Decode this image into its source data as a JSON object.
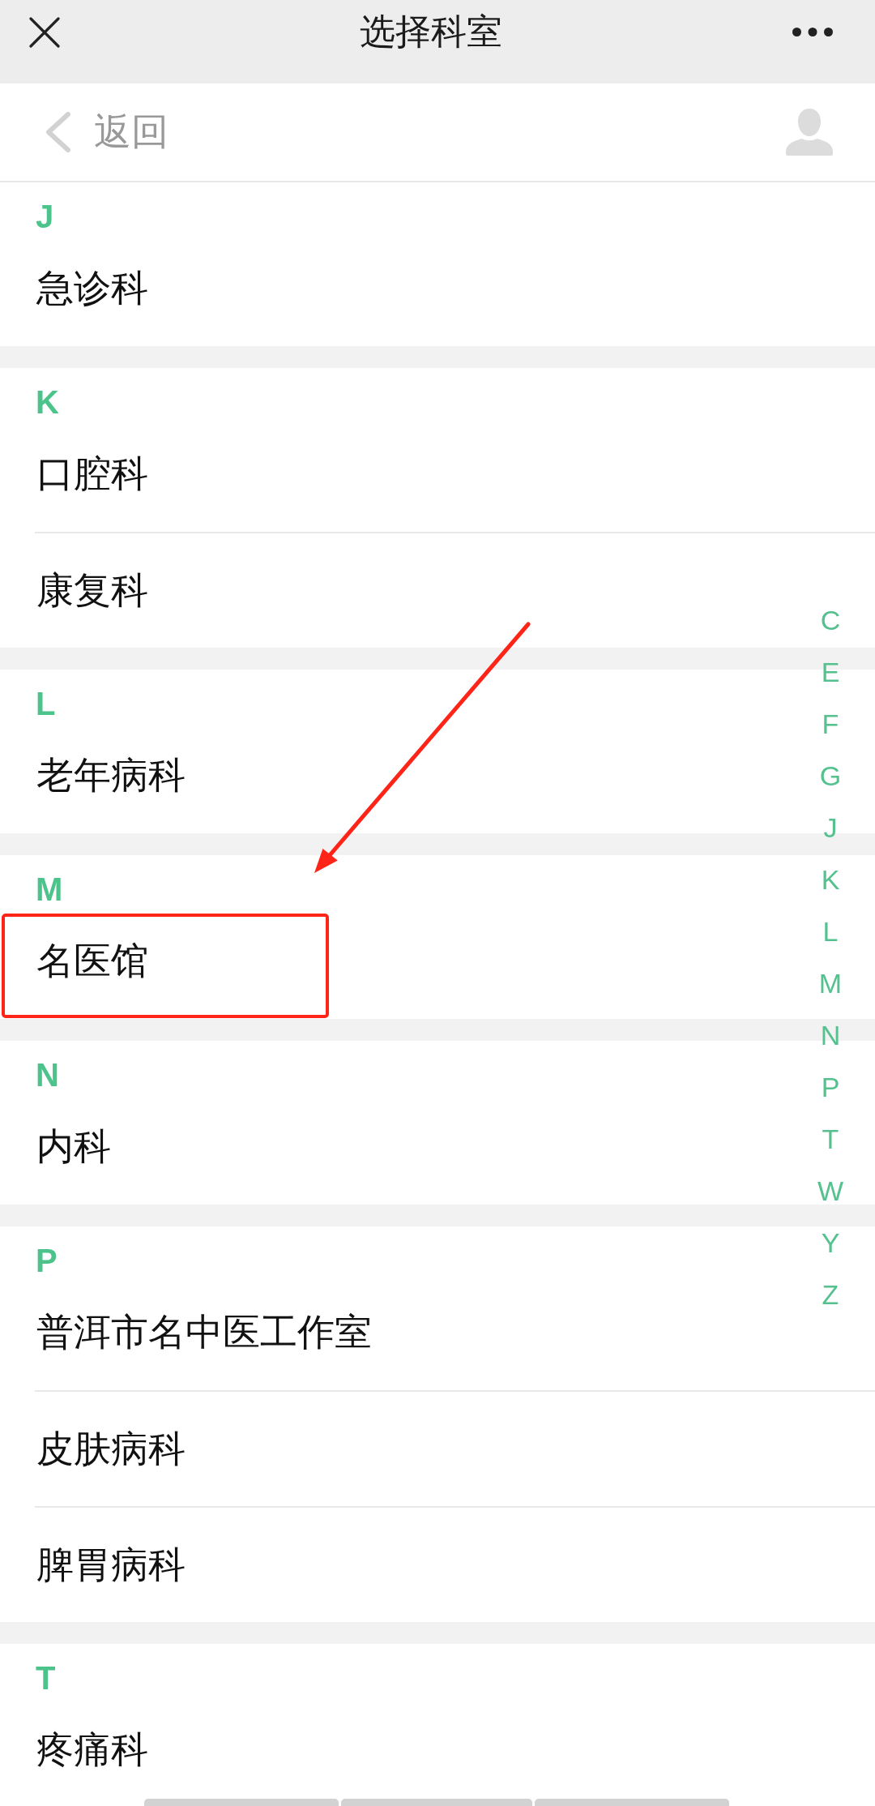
{
  "window": {
    "title": "选择科室"
  },
  "nav": {
    "back_label": "返回"
  },
  "sections": [
    {
      "letter": "J",
      "items": [
        {
          "name": "急诊科",
          "highlighted": false
        }
      ]
    },
    {
      "letter": "K",
      "items": [
        {
          "name": "口腔科",
          "highlighted": false
        },
        {
          "name": "康复科",
          "highlighted": false
        }
      ]
    },
    {
      "letter": "L",
      "items": [
        {
          "name": "老年病科",
          "highlighted": false
        }
      ]
    },
    {
      "letter": "M",
      "items": [
        {
          "name": "名医馆",
          "highlighted": true
        }
      ]
    },
    {
      "letter": "N",
      "items": [
        {
          "name": "内科",
          "highlighted": false
        }
      ]
    },
    {
      "letter": "P",
      "items": [
        {
          "name": "普洱市名中医工作室",
          "highlighted": false
        },
        {
          "name": "皮肤病科",
          "highlighted": false
        },
        {
          "name": "脾胃病科",
          "highlighted": false
        }
      ]
    },
    {
      "letter": "T",
      "items": [
        {
          "name": "疼痛科",
          "highlighted": false
        }
      ]
    }
  ],
  "index_bar": [
    "C",
    "E",
    "F",
    "G",
    "J",
    "K",
    "L",
    "M",
    "N",
    "P",
    "T",
    "W",
    "Y",
    "Z"
  ]
}
